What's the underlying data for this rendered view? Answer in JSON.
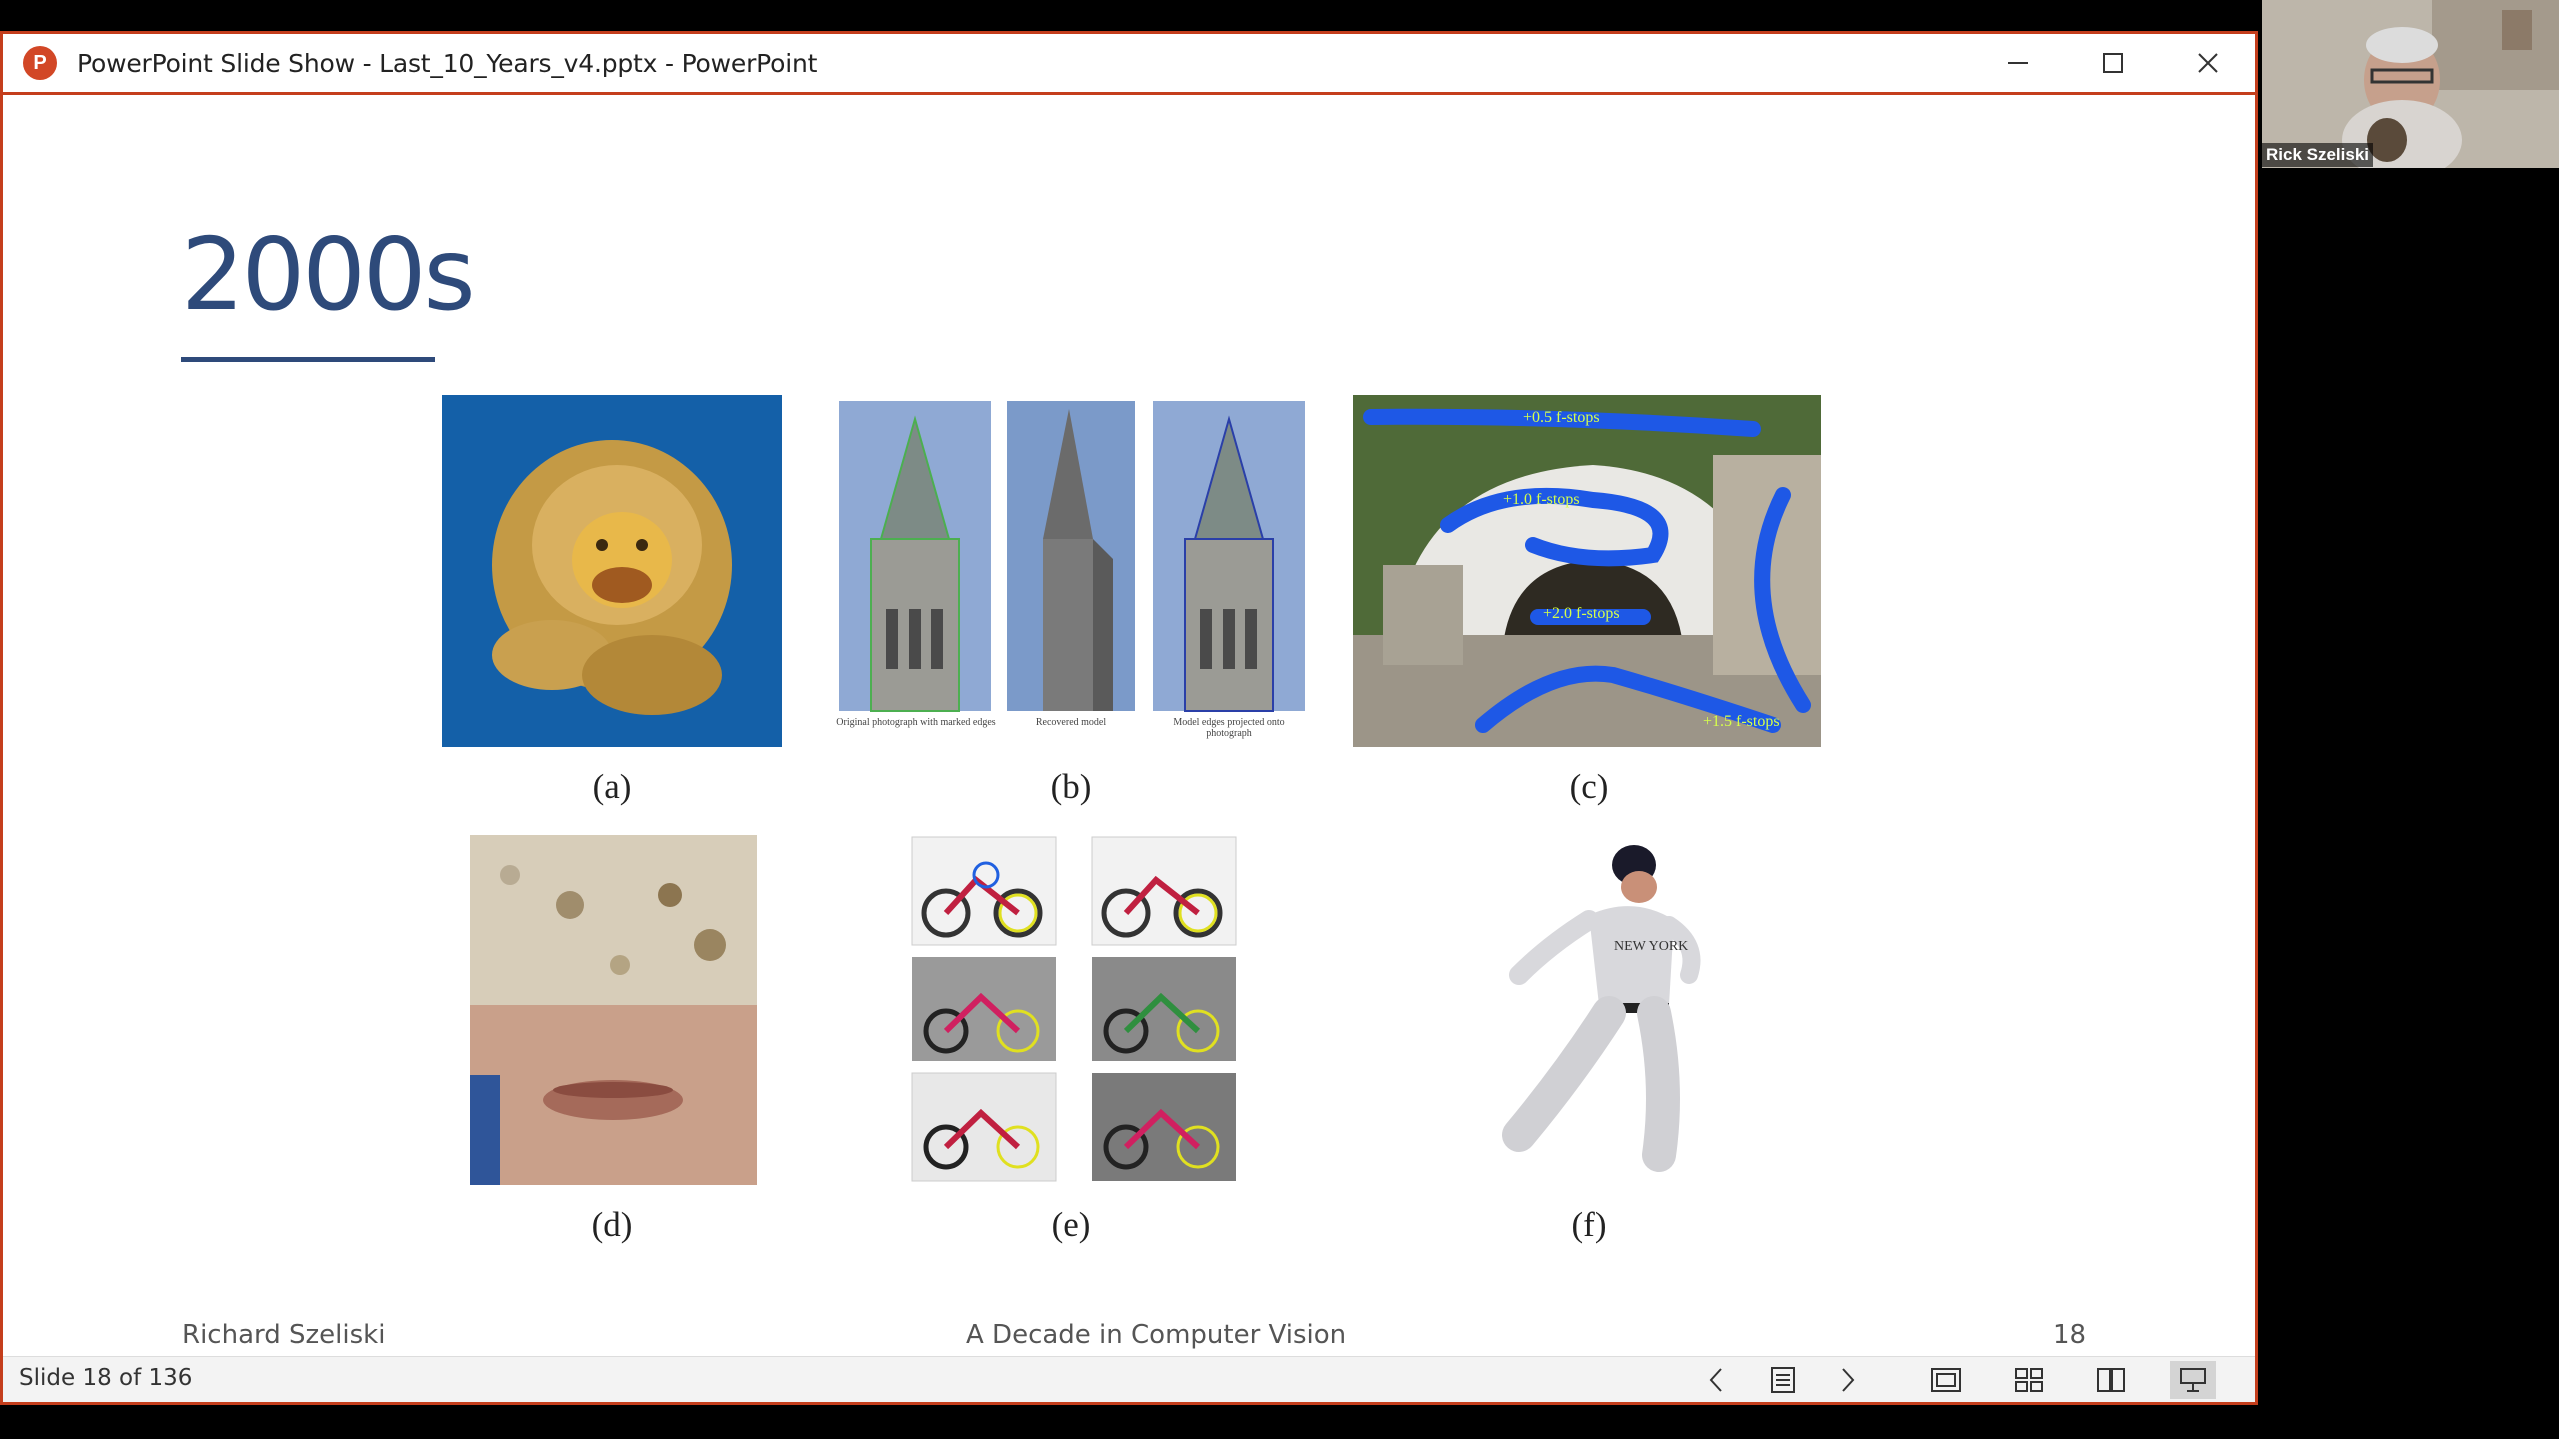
{
  "window": {
    "title": "PowerPoint Slide Show  -  Last_10_Years_v4.pptx - PowerPoint",
    "app_icon_letter": "P",
    "accent_color": "#c43e1c"
  },
  "slide": {
    "title": "2000s",
    "captions": {
      "a": "(a)",
      "b": "(b)",
      "c": "(c)",
      "d": "(d)",
      "e": "(e)",
      "f": "(f)"
    },
    "figure_b_labels": [
      "Original photograph with marked edges",
      "Recovered model",
      "Model edges projected onto photograph"
    ],
    "figure_c_labels": [
      "+0.5 f-stops",
      "+1.0 f-stops",
      "+2.0 f-stops",
      "+1.5 f-stops"
    ],
    "footer": {
      "author": "Richard Szeliski",
      "center": "A Decade in Computer Vision",
      "page": "18"
    }
  },
  "statusbar": {
    "slide_indicator": "Slide 18 of 136",
    "icons": [
      "previous-slide-icon",
      "slide-menu-icon",
      "next-slide-icon",
      "normal-view-icon",
      "slide-sorter-icon",
      "reading-view-icon",
      "slideshow-icon"
    ]
  },
  "video": {
    "participant_name": "Rick Szeliski"
  }
}
